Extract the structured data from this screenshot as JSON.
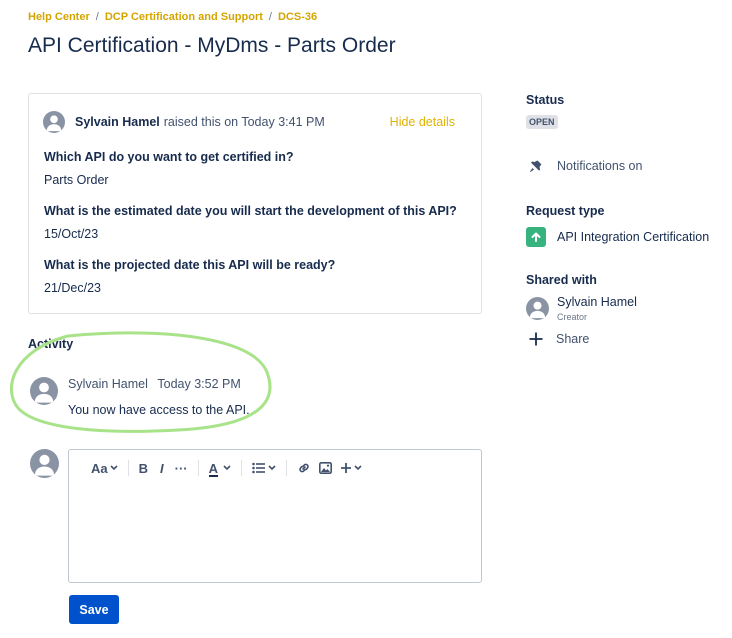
{
  "breadcrumb": {
    "items": [
      "Help Center",
      "DCP Certification and Support",
      "DCS-36"
    ],
    "separator": "/"
  },
  "request": {
    "title": "API Certification - MyDms - Parts Order",
    "reporter": "Sylvain Hamel",
    "raised_text": "raised this on Today 3:41 PM",
    "hide_details_label": "Hide details",
    "fields": [
      {
        "question": "Which API do you want to get certified in?",
        "answer": "Parts Order"
      },
      {
        "question": "What is the estimated date you will start the development of this API?",
        "answer": "15/Oct/23"
      },
      {
        "question": "What is the projected date this API will be ready?",
        "answer": "21/Dec/23"
      }
    ]
  },
  "activity": {
    "heading": "Activity",
    "comments": [
      {
        "author": "Sylvain Hamel",
        "time": "Today 3:52 PM",
        "text": "You now have access to the API."
      }
    ]
  },
  "editor": {
    "toolbar": {
      "text_style": "Aa",
      "bold": "B",
      "italic": "I",
      "more": "···",
      "color": "A"
    },
    "save_label": "Save"
  },
  "sidebar": {
    "status_label": "Status",
    "status_value": "OPEN",
    "notifications_label": "Notifications on",
    "request_type_label": "Request type",
    "request_type_value": "API Integration Certification",
    "shared_with_label": "Shared with",
    "shared_user": {
      "name": "Sylvain Hamel",
      "role": "Creator"
    },
    "share_label": "Share"
  },
  "colors": {
    "breadcrumb": "#d4a500",
    "primary_button": "#0052cc",
    "request_type_icon": "#36b37e",
    "highlight_outline": "#a8e38a"
  }
}
